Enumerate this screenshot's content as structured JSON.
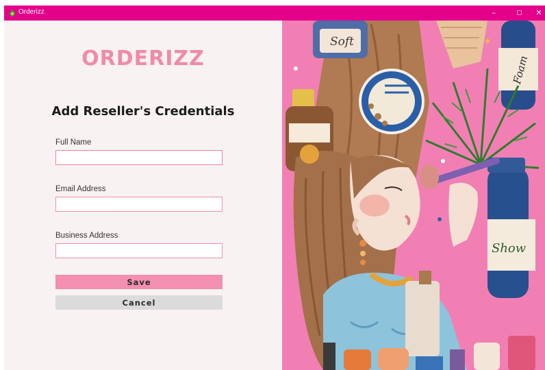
{
  "window": {
    "title": "Orderizz",
    "controls": {
      "minimize": "–",
      "close": "✕"
    },
    "titlebar_color": "#e4008b"
  },
  "form": {
    "logo": "ORDERIZZ",
    "heading": "Add Reseller's Credentials",
    "fields": [
      {
        "label": "Full Name",
        "value": "",
        "placeholder": ""
      },
      {
        "label": "Email Address",
        "value": "",
        "placeholder": ""
      },
      {
        "label": "Business Address",
        "value": "",
        "placeholder": ""
      }
    ],
    "save_label": "Save",
    "cancel_label": "Cancel",
    "accent_color": "#f18aaa"
  },
  "illustration": {
    "jar_label": "Soft",
    "bottle_label_top": "Foam",
    "bottle_label_right": "Show"
  }
}
